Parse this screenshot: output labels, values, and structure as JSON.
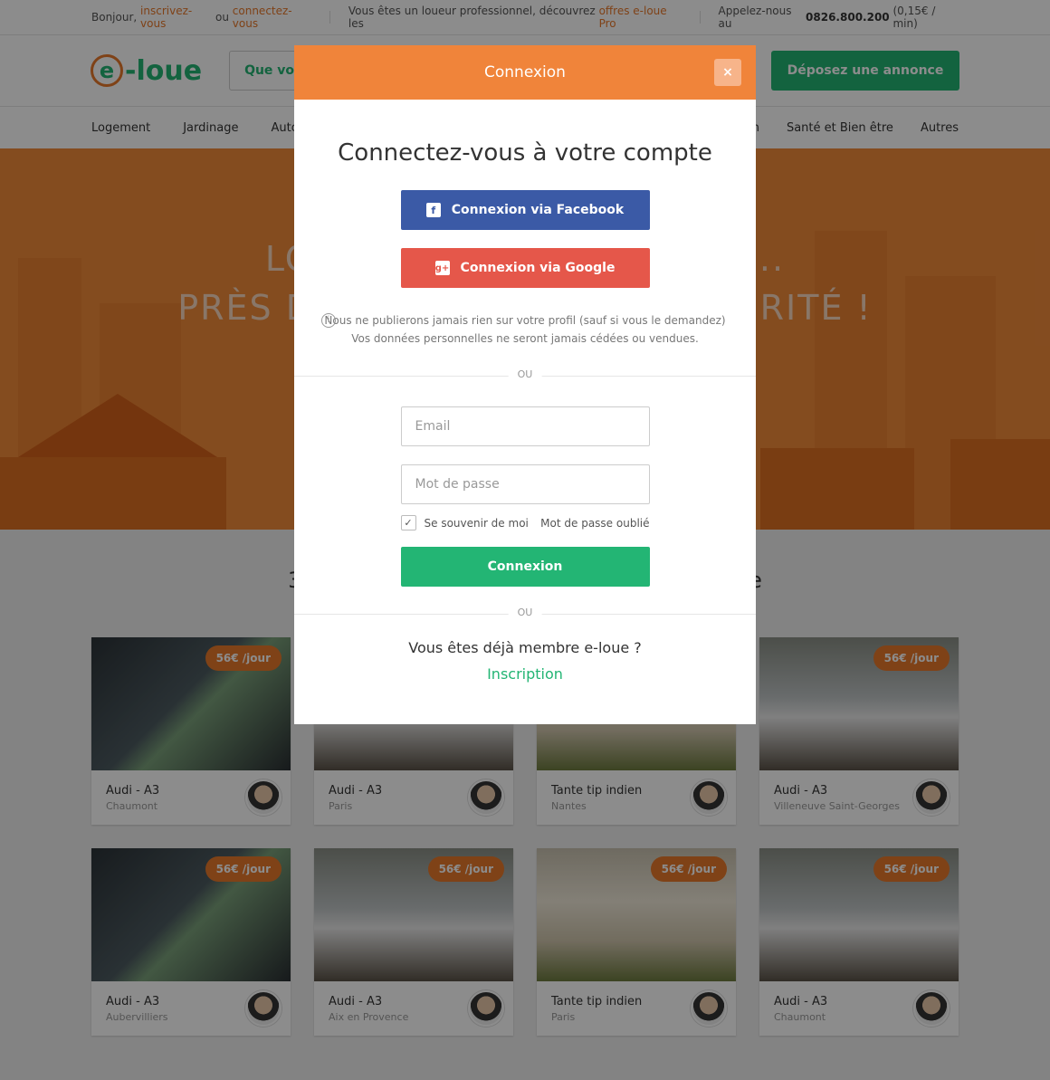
{
  "topbar": {
    "hello": "Bonjour,",
    "signup_link": "inscrivez-vous",
    "or": "ou",
    "login_link": "connectez-vous",
    "pro_text": "Vous êtes un loueur professionnel, découvrez les",
    "pro_link": "offres e-loue Pro",
    "call_text": "Appelez-nous au",
    "phone": "0826.800.200",
    "phone_rate": "(0,15€ / min)"
  },
  "header": {
    "logo_text": "-loue",
    "logo_letter": "e",
    "search_placeholder": "Que voul",
    "post_button": "Déposez une annonce"
  },
  "nav": {
    "items": [
      "Logement",
      "Jardinage",
      "Auto"
    ],
    "right_items": [
      "n",
      "Santé et Bien être",
      "Autres"
    ]
  },
  "hero": {
    "line1": "LOU                              E...",
    "line2": "PRÈS DE                             CURITÉ !"
  },
  "listings": {
    "count_title": "324                                                         nce",
    "cards": [
      {
        "title": "Audi - A3",
        "city": "Chaumont",
        "price": "56€ /jour",
        "img": "bike"
      },
      {
        "title": "Audi - A3",
        "city": "Paris",
        "price": "56€ /jour",
        "img": "car"
      },
      {
        "title": "Tante tip indien",
        "city": "Nantes",
        "price": "56€ /jour",
        "img": "tent"
      },
      {
        "title": "Audi - A3",
        "city": "Villeneuve Saint-Georges",
        "price": "56€ /jour",
        "img": "car"
      },
      {
        "title": "Audi - A3",
        "city": "Aubervilliers",
        "price": "56€ /jour",
        "img": "bike"
      },
      {
        "title": "Audi - A3",
        "city": "Aix en Provence",
        "price": "56€ /jour",
        "img": "car"
      },
      {
        "title": "Tante tip indien",
        "city": "Paris",
        "price": "56€ /jour",
        "img": "tent"
      },
      {
        "title": "Audi - A3",
        "city": "Chaumont",
        "price": "56€ /jour",
        "img": "car"
      }
    ]
  },
  "modal": {
    "header": "Connexion",
    "close": "×",
    "title": "Connectez-vous à votre compte",
    "facebook_button": "Connexion via Facebook",
    "google_button": "Connexion via Google",
    "notice_line1": "Nous ne publierons jamais rien sur votre profil (sauf si vous le demandez)",
    "notice_line2": "Vos données personnelles ne seront jamais cédées ou vendues.",
    "divider": "OU",
    "email_placeholder": "Email",
    "password_placeholder": "Mot de passe",
    "remember_label": "Se souvenir de moi",
    "forgot_link": "Mot de passe oublié",
    "login_button": "Connexion",
    "member_question": "Vous êtes déjà membre e-loue ?",
    "signup_link": "Inscription"
  },
  "colors": {
    "orange": "#f0843a",
    "green": "#23b574",
    "facebook": "#3b5aa6",
    "google": "#e5574a"
  }
}
